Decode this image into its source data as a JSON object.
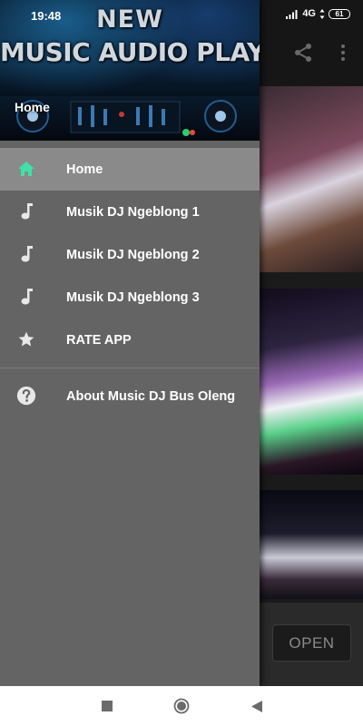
{
  "status_bar": {
    "time": "19:48",
    "network": "4G",
    "battery": "61"
  },
  "drawer": {
    "header": {
      "title_line1": "NEW",
      "title_line2": "MUSIC AUDIO PLAYER",
      "current_section": "Home"
    },
    "menu": [
      {
        "label": "Home",
        "icon": "home-icon",
        "active": true
      },
      {
        "label": "Musik DJ Ngeblong 1",
        "icon": "music-note-icon"
      },
      {
        "label": "Musik DJ Ngeblong 2",
        "icon": "music-note-icon"
      },
      {
        "label": "Musik DJ Ngeblong 3",
        "icon": "music-note-icon"
      },
      {
        "label": "RATE APP",
        "icon": "star-icon"
      }
    ],
    "secondary_menu": [
      {
        "label": "About Music DJ Bus Oleng",
        "icon": "help-circle-icon"
      }
    ]
  },
  "toolbar": {
    "share_icon": "share-icon",
    "more_icon": "more-vert-icon"
  },
  "ad": {
    "open_label": "OPEN"
  },
  "navigation_bar": {
    "recent": "square-icon",
    "home": "circle-icon",
    "back": "back-triangle-icon"
  },
  "colors": {
    "drawer_bg": "#646464",
    "active_item_bg": "#8a8a8a",
    "home_icon": "#40e0a8",
    "icon_gray": "#e8e8e8"
  }
}
